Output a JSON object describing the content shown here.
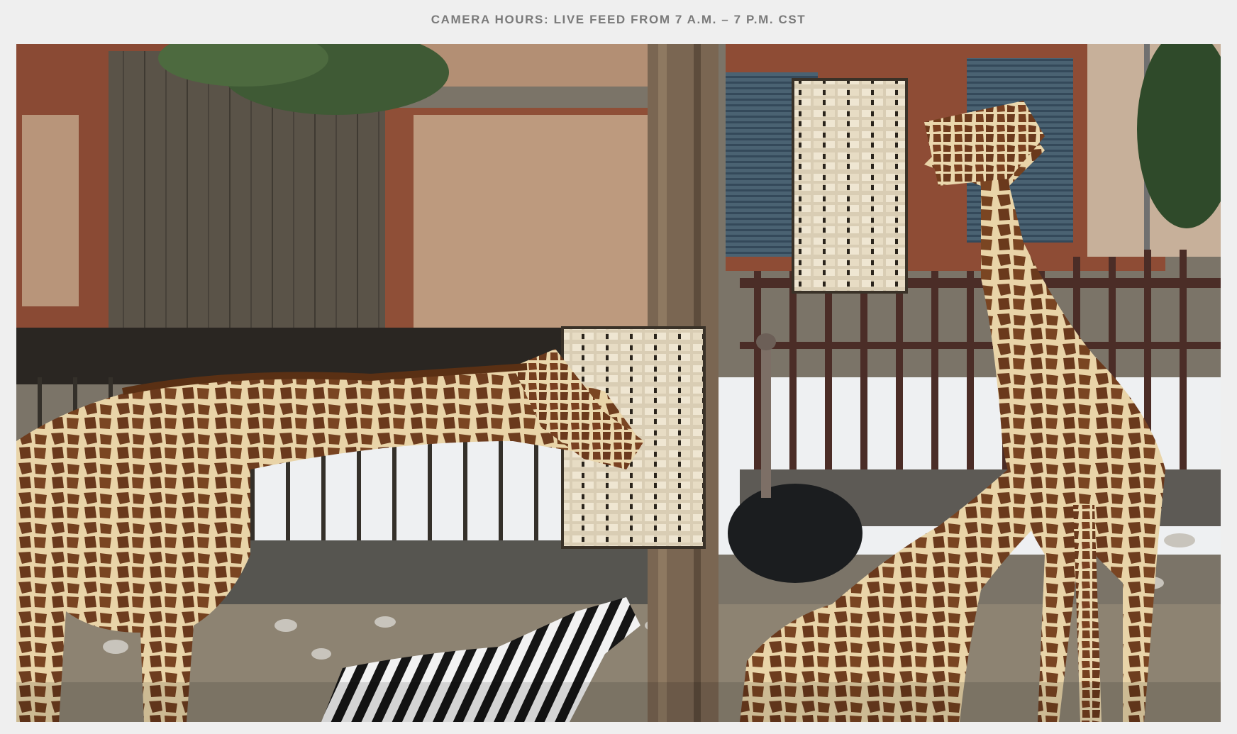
{
  "camera_hours": "CAMERA HOURS: LIVE FEED FROM 7 A.M. – 7 P.M. CST",
  "feed": {
    "description_icon": "live-camera-feed",
    "colors": {
      "page_bg": "#efefef",
      "header_text": "#7a7a7a",
      "wall_stucco": "#b8957a",
      "wall_trim": "#8a4a34",
      "fence": "#4a2e28",
      "shutter": "#3e5566",
      "giraffe_base": "#e8d2a6",
      "giraffe_spot": "#6b3c1e",
      "ground": "#8c8272"
    }
  }
}
